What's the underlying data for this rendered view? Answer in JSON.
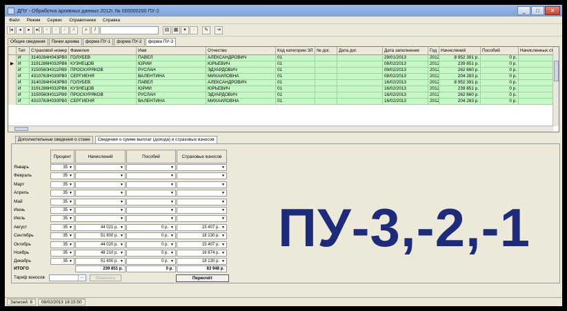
{
  "window": {
    "title": "ДПУ - Обработка архивных данных  2012г. № 000000200 ПУ-2",
    "min": "_",
    "max": "□",
    "close": "×"
  },
  "menu": [
    "Файл",
    "Режим",
    "Сервис",
    "Справочники",
    "Справка"
  ],
  "top_tabs": [
    "Общие сведения",
    "Пачки архива",
    "форма ПУ-1",
    "форма ПУ-2",
    "форма ПУ-3"
  ],
  "grid": {
    "columns": [
      "Тип",
      "Страховой номер",
      "Фамилия",
      "Имя",
      "Отчество",
      "Код категории ЗЛ",
      "№ дог.",
      "Дата дог.",
      "Дата заполнения",
      "Год",
      "Начислений",
      "Пособий",
      "Начисленных стр"
    ],
    "rows": [
      [
        "И",
        "3140284H043PB0",
        "ГОЛУБЕВ",
        "ПАВЕЛ",
        "АЛЕКСАНДРОВИЧ",
        "01",
        "",
        "",
        "29/01/2013",
        "2012",
        "8 952 391 р.",
        "0 р."
      ],
      [
        "И",
        "3191286H032PB6",
        "КУЗНЕЦОВ",
        "ЮРИЙ",
        "ЮРЬЕВИЧ",
        "01",
        "",
        "",
        "08/02/2013",
        "2012",
        "239 851 р.",
        "0 р."
      ],
      [
        "И",
        "3150560H011PB9",
        "ПРОСКУРЯКОВ",
        "РУСЛАН",
        "ЭДУАРДОВИЧ",
        "01",
        "",
        "",
        "09/02/2013",
        "2012",
        "262 660 р.",
        "0 р."
      ],
      [
        "И",
        "4310763H030PB0",
        "СЕРГИЕНЯ",
        "ВАЛЕНТИНА",
        "МИХАЙЛОВНА",
        "01",
        "",
        "",
        "08/02/2013",
        "2012",
        "204 283 р.",
        "0 р."
      ],
      [
        "И",
        "3140284H043PB0",
        "ГОЛУБЕВ",
        "ПАВЕЛ",
        "АЛЕКСАНДРОВИЧ",
        "01",
        "",
        "",
        "16/02/2013",
        "2012",
        "8 952 391 р.",
        "0 р."
      ],
      [
        "И",
        "3191286H032PB6",
        "КУЗНЕЦОВ",
        "ЮРИЙ",
        "ЮРЬЕВИЧ",
        "01",
        "",
        "",
        "16/02/2013",
        "2012",
        "239 851 р.",
        "0 р."
      ],
      [
        "И",
        "3150560H011PB9",
        "ПРОСКУРЯКОВ",
        "РУСЛАН",
        "ЭДУАРДОВИЧ",
        "01",
        "",
        "",
        "16/02/2013",
        "2012",
        "262 660 р.",
        "0 р."
      ],
      [
        "И",
        "4310763H030PB0",
        "СЕРГИЕНЯ",
        "ВАЛЕНТИНА",
        "МИХАЙЛОВНА",
        "01",
        "",
        "",
        "16/02/2013",
        "2012",
        "204 283 р.",
        "0 р."
      ]
    ],
    "current_row_marker": "▶"
  },
  "bottom_tabs": [
    "Дополнительные сведения о стаже",
    "Сведения о сумме выплат (дохода) и страховых взносов"
  ],
  "form": {
    "headers": [
      "Процент",
      "Начислений",
      "Пособий",
      "Страховых взносов"
    ],
    "months": [
      {
        "m": "Январь",
        "p": "35",
        "n": "",
        "s": "",
        "v": ""
      },
      {
        "m": "Февраль",
        "p": "35",
        "n": "",
        "s": "",
        "v": ""
      },
      {
        "m": "Март",
        "p": "35",
        "n": "",
        "s": "",
        "v": ""
      },
      {
        "m": "Апрель",
        "p": "35",
        "n": "",
        "s": "",
        "v": ""
      },
      {
        "m": "Май",
        "p": "35",
        "n": "",
        "s": "",
        "v": ""
      },
      {
        "m": "Июнь",
        "p": "35",
        "n": "",
        "s": "",
        "v": ""
      },
      {
        "m": "Июль",
        "p": "35",
        "n": "",
        "s": "",
        "v": ""
      },
      {
        "m": "Август",
        "p": "35",
        "n": "44 021 р.",
        "s": "0 р.",
        "v": "15 407 р."
      },
      {
        "m": "Сентябрь",
        "p": "35",
        "n": "51 800 р.",
        "s": "0 р.",
        "v": "18 130 р."
      },
      {
        "m": "Октябрь",
        "p": "35",
        "n": "44 020 р.",
        "s": "0 р.",
        "v": "15 407 р."
      },
      {
        "m": "Ноябрь",
        "p": "35",
        "n": "48 210 р.",
        "s": "0 р.",
        "v": "16 874 р."
      },
      {
        "m": "Декабрь",
        "p": "35",
        "n": "51 800 р.",
        "s": "0 р.",
        "v": "18 130 р."
      }
    ],
    "total_label": "ИТОГО",
    "totals": {
      "n": "239 851 р.",
      "s": "0 р.",
      "v": "83 948 р."
    },
    "tariff_label": "Тариф взносов",
    "change_button": "Изменить",
    "recalc_button": "Пересчёт"
  },
  "overlay_title": "ПУ-3,-2,-1",
  "status": {
    "records": "Записей: 8",
    "datetime": "08/02/2013 18:15:50"
  }
}
